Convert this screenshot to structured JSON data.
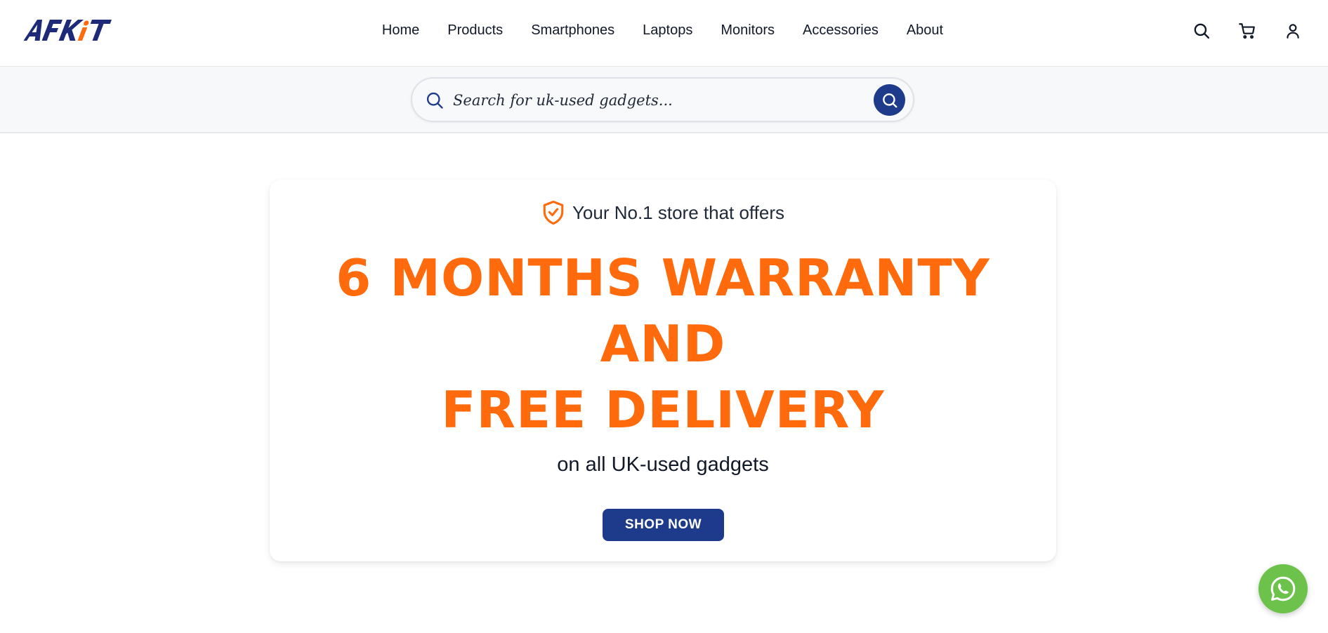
{
  "brand": {
    "logo_text": "AFKiT"
  },
  "nav": {
    "items": [
      {
        "label": "Home"
      },
      {
        "label": "Products"
      },
      {
        "label": "Smartphones"
      },
      {
        "label": "Laptops"
      },
      {
        "label": "Monitors"
      },
      {
        "label": "Accessories"
      },
      {
        "label": "About"
      }
    ]
  },
  "header_icons": [
    "search-icon",
    "cart-icon",
    "user-icon"
  ],
  "search": {
    "placeholder": "Search for uk-used gadgets...",
    "value": ""
  },
  "hero": {
    "tagline": "Your No.1 store that offers",
    "headline_line1": "6 MONTHS WARRANTY",
    "headline_line2": "AND",
    "headline_line3": "FREE DELIVERY",
    "subtext": "on all UK-used gadgets",
    "cta_label": "SHOP NOW"
  },
  "colors": {
    "accent_orange": "#ff6a0d",
    "brand_blue": "#1e3a8a",
    "whatsapp_green": "#6cc24a"
  }
}
